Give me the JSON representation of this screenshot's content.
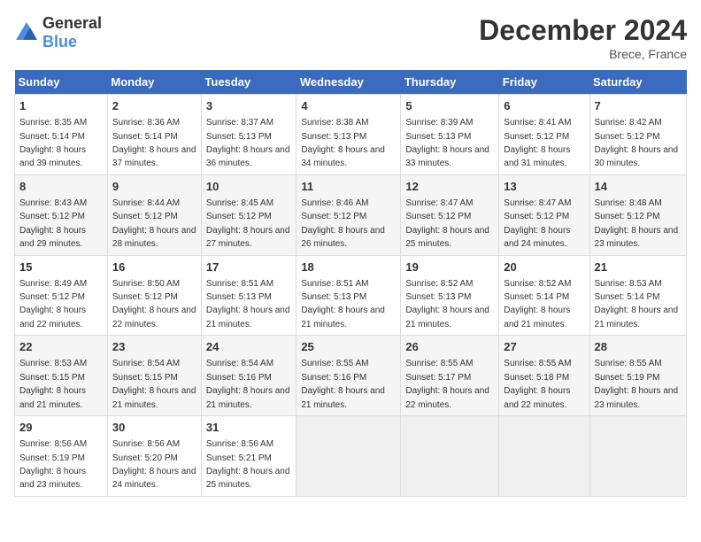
{
  "header": {
    "logo_general": "General",
    "logo_blue": "Blue",
    "title": "December 2024",
    "subtitle": "Brece, France"
  },
  "weekdays": [
    "Sunday",
    "Monday",
    "Tuesday",
    "Wednesday",
    "Thursday",
    "Friday",
    "Saturday"
  ],
  "weeks": [
    [
      {
        "day": "1",
        "sunrise": "8:35 AM",
        "sunset": "5:14 PM",
        "daylight": "8 hours and 39 minutes."
      },
      {
        "day": "2",
        "sunrise": "8:36 AM",
        "sunset": "5:14 PM",
        "daylight": "8 hours and 37 minutes."
      },
      {
        "day": "3",
        "sunrise": "8:37 AM",
        "sunset": "5:13 PM",
        "daylight": "8 hours and 36 minutes."
      },
      {
        "day": "4",
        "sunrise": "8:38 AM",
        "sunset": "5:13 PM",
        "daylight": "8 hours and 34 minutes."
      },
      {
        "day": "5",
        "sunrise": "8:39 AM",
        "sunset": "5:13 PM",
        "daylight": "8 hours and 33 minutes."
      },
      {
        "day": "6",
        "sunrise": "8:41 AM",
        "sunset": "5:12 PM",
        "daylight": "8 hours and 31 minutes."
      },
      {
        "day": "7",
        "sunrise": "8:42 AM",
        "sunset": "5:12 PM",
        "daylight": "8 hours and 30 minutes."
      }
    ],
    [
      {
        "day": "8",
        "sunrise": "8:43 AM",
        "sunset": "5:12 PM",
        "daylight": "8 hours and 29 minutes."
      },
      {
        "day": "9",
        "sunrise": "8:44 AM",
        "sunset": "5:12 PM",
        "daylight": "8 hours and 28 minutes."
      },
      {
        "day": "10",
        "sunrise": "8:45 AM",
        "sunset": "5:12 PM",
        "daylight": "8 hours and 27 minutes."
      },
      {
        "day": "11",
        "sunrise": "8:46 AM",
        "sunset": "5:12 PM",
        "daylight": "8 hours and 26 minutes."
      },
      {
        "day": "12",
        "sunrise": "8:47 AM",
        "sunset": "5:12 PM",
        "daylight": "8 hours and 25 minutes."
      },
      {
        "day": "13",
        "sunrise": "8:47 AM",
        "sunset": "5:12 PM",
        "daylight": "8 hours and 24 minutes."
      },
      {
        "day": "14",
        "sunrise": "8:48 AM",
        "sunset": "5:12 PM",
        "daylight": "8 hours and 23 minutes."
      }
    ],
    [
      {
        "day": "15",
        "sunrise": "8:49 AM",
        "sunset": "5:12 PM",
        "daylight": "8 hours and 22 minutes."
      },
      {
        "day": "16",
        "sunrise": "8:50 AM",
        "sunset": "5:12 PM",
        "daylight": "8 hours and 22 minutes."
      },
      {
        "day": "17",
        "sunrise": "8:51 AM",
        "sunset": "5:13 PM",
        "daylight": "8 hours and 21 minutes."
      },
      {
        "day": "18",
        "sunrise": "8:51 AM",
        "sunset": "5:13 PM",
        "daylight": "8 hours and 21 minutes."
      },
      {
        "day": "19",
        "sunrise": "8:52 AM",
        "sunset": "5:13 PM",
        "daylight": "8 hours and 21 minutes."
      },
      {
        "day": "20",
        "sunrise": "8:52 AM",
        "sunset": "5:14 PM",
        "daylight": "8 hours and 21 minutes."
      },
      {
        "day": "21",
        "sunrise": "8:53 AM",
        "sunset": "5:14 PM",
        "daylight": "8 hours and 21 minutes."
      }
    ],
    [
      {
        "day": "22",
        "sunrise": "8:53 AM",
        "sunset": "5:15 PM",
        "daylight": "8 hours and 21 minutes."
      },
      {
        "day": "23",
        "sunrise": "8:54 AM",
        "sunset": "5:15 PM",
        "daylight": "8 hours and 21 minutes."
      },
      {
        "day": "24",
        "sunrise": "8:54 AM",
        "sunset": "5:16 PM",
        "daylight": "8 hours and 21 minutes."
      },
      {
        "day": "25",
        "sunrise": "8:55 AM",
        "sunset": "5:16 PM",
        "daylight": "8 hours and 21 minutes."
      },
      {
        "day": "26",
        "sunrise": "8:55 AM",
        "sunset": "5:17 PM",
        "daylight": "8 hours and 22 minutes."
      },
      {
        "day": "27",
        "sunrise": "8:55 AM",
        "sunset": "5:18 PM",
        "daylight": "8 hours and 22 minutes."
      },
      {
        "day": "28",
        "sunrise": "8:55 AM",
        "sunset": "5:19 PM",
        "daylight": "8 hours and 23 minutes."
      }
    ],
    [
      {
        "day": "29",
        "sunrise": "8:56 AM",
        "sunset": "5:19 PM",
        "daylight": "8 hours and 23 minutes."
      },
      {
        "day": "30",
        "sunrise": "8:56 AM",
        "sunset": "5:20 PM",
        "daylight": "8 hours and 24 minutes."
      },
      {
        "day": "31",
        "sunrise": "8:56 AM",
        "sunset": "5:21 PM",
        "daylight": "8 hours and 25 minutes."
      },
      null,
      null,
      null,
      null
    ]
  ]
}
